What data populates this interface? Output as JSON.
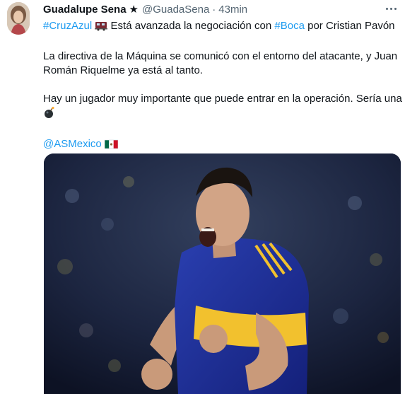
{
  "author": {
    "display_name": "Guadalupe Sena",
    "star": "★",
    "handle": "@GuadaSena",
    "separator": "·",
    "time": "43min"
  },
  "tweet": {
    "hashtag_cruzazul": "#CruzAzul",
    "line1_text": "Está avanzada la negociación con",
    "hashtag_boca": "#Boca",
    "line1_tail": "por Cristian Pavón",
    "para2_line1": "La directiva de la Máquina se comunicó con el entorno del atacante, y Juan",
    "para2_line2": "Román Riquelme ya está al tanto.",
    "para3_line1": "Hay un jugador muy importante que puede entrar en la operación. Sería una",
    "mention": "@ASMexico"
  },
  "icons": {
    "train": "train-emoji-icon",
    "bomb": "bomb-emoji-icon",
    "flag": "mexico-flag-icon",
    "more": "more-options-icon"
  },
  "colors": {
    "link": "#1d9bf0",
    "secondary_text": "#536471",
    "primary_text": "#0f1419"
  }
}
